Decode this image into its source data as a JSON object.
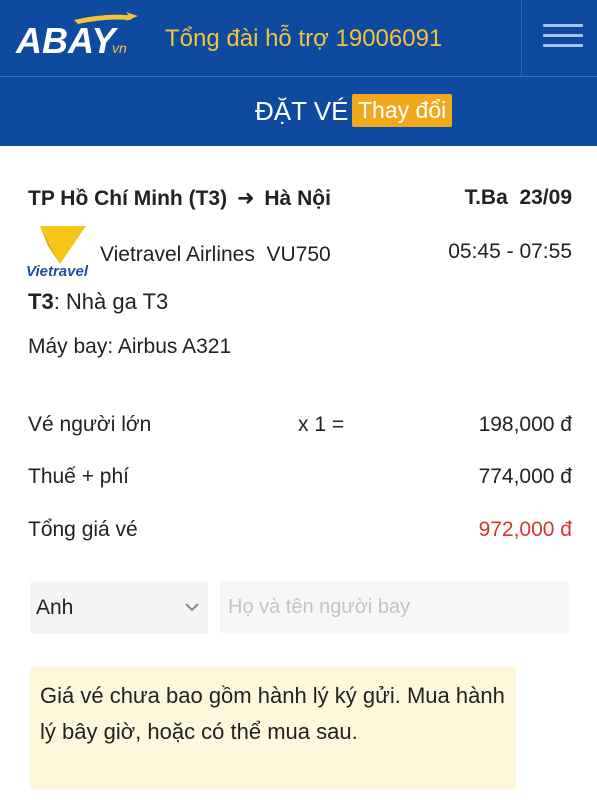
{
  "header": {
    "logo_text": "ABAY.vn",
    "hotline": "Tổng đài hỗ trợ 19006091",
    "menu_icon": "hamburger-menu-icon"
  },
  "subheader": {
    "title": "ĐẶT VÉ",
    "change_label": "Thay đổi"
  },
  "flight": {
    "route_from": "TP Hồ Chí Minh (T3)",
    "route_arrow": "➜",
    "route_to": "Hà Nội",
    "date": "T.Ba  23/09",
    "airline_logo_text": "Vietravel",
    "airline": "Vietravel Airlines  VU750",
    "times": "05:45 - 07:55",
    "terminal_code": "T3",
    "terminal_desc": ": Nhà ga T3",
    "aircraft": "Máy bay: Airbus A321"
  },
  "pricing": {
    "adult_label": "Vé người lớn",
    "adult_qty": "x 1 =",
    "adult_price": "198,000 đ",
    "tax_label": "Thuế + phí",
    "tax_price": "774,000 đ",
    "total_label": "Tổng giá vé",
    "total_price": "972,000 đ"
  },
  "passenger": {
    "title_value": "Anh",
    "name_placeholder": "Họ và tên người bay"
  },
  "notice": {
    "text": "Giá vé chưa bao gồm hành lý ký gửi. Mua hành lý bây giờ, hoặc có thể mua sau."
  },
  "colors": {
    "header_bg": "#0d4aa0",
    "hotline": "#f6c23a",
    "change_btn": "#f2a81d",
    "total_price": "#d7372f",
    "notice_bg": "#fdf8dc"
  }
}
